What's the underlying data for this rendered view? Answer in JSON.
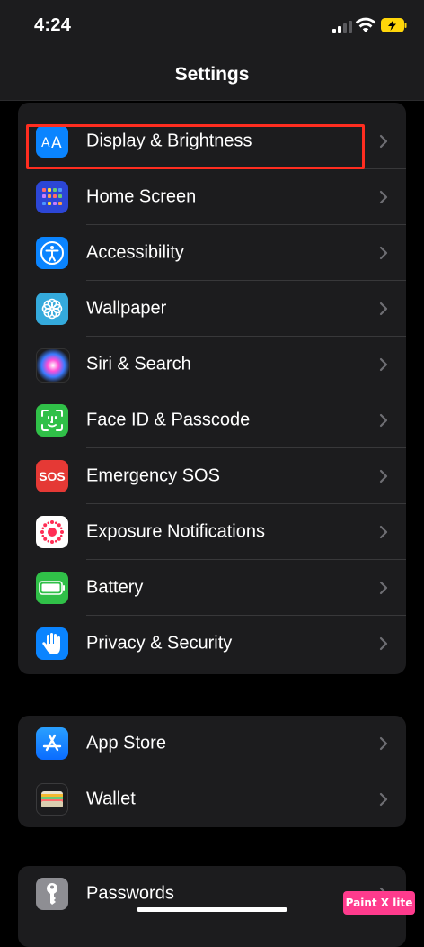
{
  "status_bar": {
    "time": "4:24"
  },
  "nav": {
    "title": "Settings"
  },
  "groups": [
    {
      "rows": [
        {
          "label": "Display & Brightness",
          "icon": "aa-text-icon",
          "color": "#0a84ff"
        },
        {
          "label": "Home Screen",
          "icon": "app-grid-icon",
          "color": "#2c46d6"
        },
        {
          "label": "Accessibility",
          "icon": "accessibility-icon",
          "color": "#0a84ff"
        },
        {
          "label": "Wallpaper",
          "icon": "flower-icon",
          "color": "#34aadc"
        },
        {
          "label": "Siri & Search",
          "icon": "siri-orb-icon",
          "color": "#1c1c1e"
        },
        {
          "label": "Face ID & Passcode",
          "icon": "face-id-icon",
          "color": "#30c048"
        },
        {
          "label": "Emergency SOS",
          "icon": "sos-icon",
          "icon_text": "SOS",
          "color": "#e53935"
        },
        {
          "label": "Exposure Notifications",
          "icon": "exposure-dots-icon",
          "color": "#ffffff"
        },
        {
          "label": "Battery",
          "icon": "battery-icon",
          "color": "#30c048"
        },
        {
          "label": "Privacy & Security",
          "icon": "hand-icon",
          "color": "#0a84ff"
        }
      ]
    },
    {
      "rows": [
        {
          "label": "App Store",
          "icon": "app-store-icon",
          "color": "#1e90ff"
        },
        {
          "label": "Wallet",
          "icon": "wallet-icon",
          "color": "#1c1c1e"
        }
      ]
    },
    {
      "rows": [
        {
          "label": "Passwords",
          "icon": "key-icon",
          "color": "#8e8e93"
        }
      ]
    }
  ],
  "watermark": {
    "text": "Paint X lite"
  },
  "highlight_color": "#ff2d20"
}
